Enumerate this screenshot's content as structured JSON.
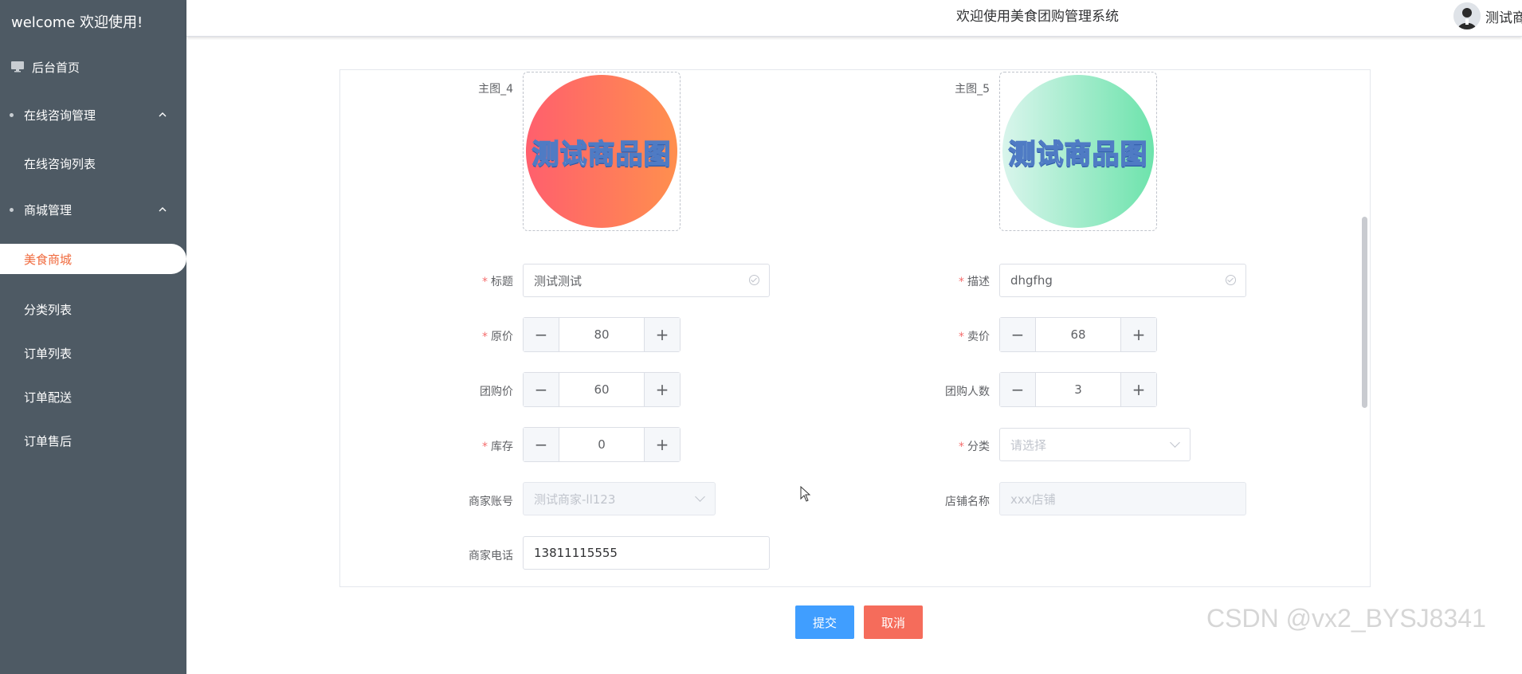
{
  "sidebar": {
    "welcome": "welcome 欢迎使用!",
    "home": "后台首页",
    "group1": "在线咨询管理",
    "group1_items": [
      "在线咨询列表"
    ],
    "group2": "商城管理",
    "group2_items": [
      "美食商城",
      "分类列表",
      "订单列表",
      "订单配送",
      "订单售后"
    ],
    "active_item": "美食商城",
    "accent_color": "#f0693c"
  },
  "header": {
    "title": "欢迎使用美食团购管理系统",
    "user_name": "测试商家"
  },
  "form": {
    "image4": {
      "label": "主图_4",
      "text": "测试商品图"
    },
    "image5": {
      "label": "主图_5",
      "text": "测试商品图"
    },
    "title": {
      "label": "标题",
      "value": "测试测试",
      "required": true
    },
    "desc": {
      "label": "描述",
      "value": "dhgfhg",
      "required": true
    },
    "original_price": {
      "label": "原价",
      "value": "80",
      "required": true
    },
    "sale_price": {
      "label": "卖价",
      "value": "68",
      "required": true
    },
    "group_price": {
      "label": "团购价",
      "value": "60"
    },
    "group_count": {
      "label": "团购人数",
      "value": "3"
    },
    "stock": {
      "label": "库存",
      "value": "0",
      "required": true
    },
    "category": {
      "label": "分类",
      "placeholder": "请选择",
      "required": true
    },
    "merchant_account": {
      "label": "商家账号",
      "value": "测试商家-ll123"
    },
    "shop_name": {
      "label": "店铺名称",
      "placeholder": "xxx店铺"
    },
    "merchant_phone": {
      "label": "商家电话",
      "value": "13811115555"
    },
    "req_mark": "*"
  },
  "buttons": {
    "submit": "提交",
    "cancel": "取消"
  },
  "watermark": "CSDN @vx2_BYSJ8341",
  "colors": {
    "primary": "#409eff",
    "danger": "#f56c5b",
    "sidebar_bg": "#4e5a64"
  }
}
